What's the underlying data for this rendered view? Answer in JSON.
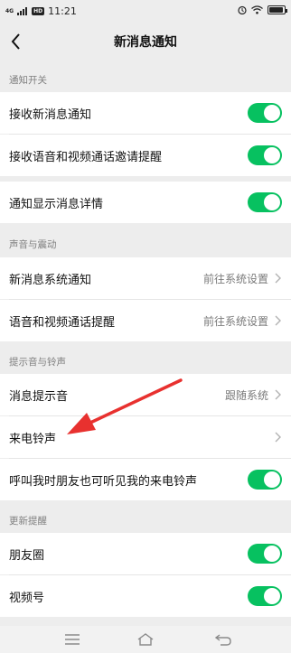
{
  "status_bar": {
    "network": "4G",
    "hd": "HD",
    "time": "11:21"
  },
  "header": {
    "title": "新消息通知"
  },
  "sections": {
    "notify_switch": {
      "label": "通知开关",
      "items": [
        {
          "label": "接收新消息通知",
          "toggle": true
        },
        {
          "label": "接收语音和视频通话邀请提醒",
          "toggle": true
        }
      ]
    },
    "show_detail": {
      "items": [
        {
          "label": "通知显示消息详情",
          "toggle": true
        }
      ]
    },
    "sound_vibrate": {
      "label": "声音与震动",
      "items": [
        {
          "label": "新消息系统通知",
          "value": "前往系统设置"
        },
        {
          "label": "语音和视频通话提醒",
          "value": "前往系统设置"
        }
      ]
    },
    "tones": {
      "label": "提示音与铃声",
      "items": [
        {
          "label": "消息提示音",
          "value": "跟随系统"
        },
        {
          "label": "来电铃声",
          "value": ""
        },
        {
          "label": "呼叫我时朋友也可听见我的来电铃声",
          "toggle": true
        }
      ]
    },
    "updates": {
      "label": "更新提醒",
      "items": [
        {
          "label": "朋友圈",
          "toggle": true
        },
        {
          "label": "视频号",
          "toggle": true
        }
      ]
    }
  },
  "colors": {
    "toggle_on": "#07c160",
    "annotation_arrow": "#e8312f"
  }
}
